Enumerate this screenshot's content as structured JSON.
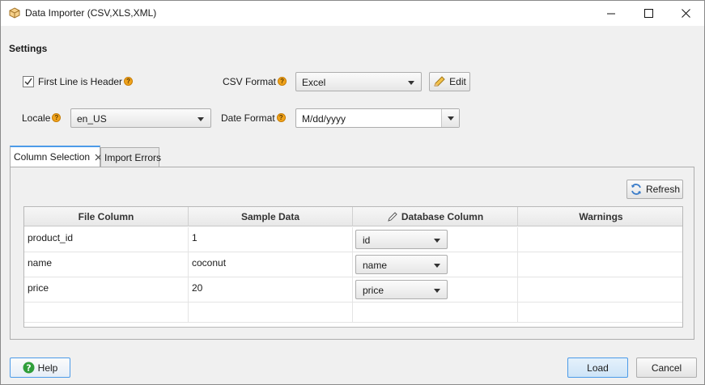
{
  "window": {
    "title": "Data Importer (CSV,XLS,XML)",
    "app_icon": "cube-icon",
    "controls": [
      "minimize-icon",
      "maximize-icon",
      "close-icon"
    ]
  },
  "settings": {
    "heading": "Settings",
    "first_line_header": {
      "label": "First Line is Header",
      "checked": true,
      "help": "?"
    },
    "csv_format": {
      "label": "CSV Format",
      "value": "Excel",
      "help": "?"
    },
    "edit_button": {
      "label": "Edit",
      "icon": "pencil-icon"
    },
    "locale": {
      "label": "Locale",
      "value": "en_US",
      "help": "?"
    },
    "date_format": {
      "label": "Date Format",
      "value": "M/dd/yyyy",
      "help": "?"
    }
  },
  "tabs": [
    {
      "label": "Column Selection",
      "active": true,
      "closable": true
    },
    {
      "label": "Import Errors",
      "active": false,
      "closable": false
    }
  ],
  "refresh_button": {
    "label": "Refresh",
    "icon": "refresh-icon"
  },
  "grid": {
    "columns": [
      "File Column",
      "Sample Data",
      "Database Column",
      "Warnings"
    ],
    "rows": [
      {
        "file_column": "product_id",
        "sample": "1",
        "db_column": "id",
        "warnings": ""
      },
      {
        "file_column": "name",
        "sample": "coconut",
        "db_column": "name",
        "warnings": ""
      },
      {
        "file_column": "price",
        "sample": "20",
        "db_column": "price",
        "warnings": ""
      }
    ]
  },
  "footer": {
    "help_button": {
      "label": "Help",
      "icon": "help-circle-icon"
    },
    "load_button": {
      "label": "Load"
    },
    "cancel_button": {
      "label": "Cancel"
    }
  },
  "colors": {
    "accent": "#4c9be8",
    "help_green": "#2f9e3a",
    "help_badge": "#f0a31c"
  }
}
